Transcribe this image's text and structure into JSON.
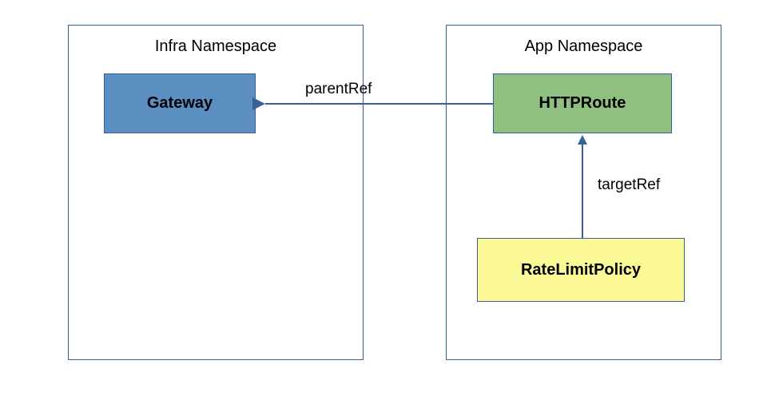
{
  "infra_namespace": {
    "title": "Infra Namespace",
    "gateway": "Gateway"
  },
  "app_namespace": {
    "title": "App Namespace",
    "httproute": "HTTPRoute",
    "policy": "RateLimitPolicy"
  },
  "edges": {
    "parentRef": "parentRef",
    "targetRef": "targetRef"
  },
  "colors": {
    "border": "#3a5f9a",
    "gateway_fill": "#5b8ec1",
    "httproute_fill": "#8fc07f",
    "policy_fill": "#fcf997"
  }
}
